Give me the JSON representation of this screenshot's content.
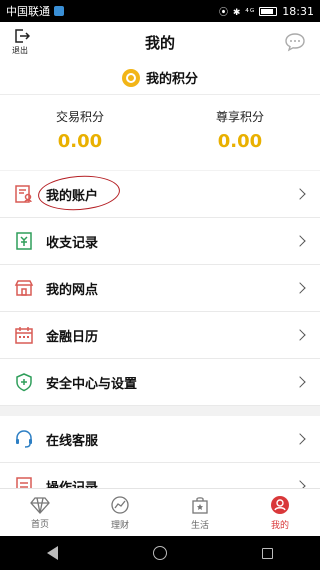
{
  "status_bar": {
    "carrier": "中国联通",
    "icons_text": "⦿ ✱ ⁴ᴳ",
    "time": "18:31"
  },
  "header": {
    "logout_label": "退出",
    "title": "我的",
    "points_title": "我的积分",
    "trade_points_label": "交易积分",
    "trade_points_value": "0.00",
    "premium_points_label": "尊享积分",
    "premium_points_value": "0.00"
  },
  "menu": {
    "group1": [
      {
        "label": "我的账户",
        "icon": "account-card-icon"
      },
      {
        "label": "收支记录",
        "icon": "ledger-icon"
      },
      {
        "label": "我的网点",
        "icon": "store-icon"
      },
      {
        "label": "金融日历",
        "icon": "calendar-icon"
      },
      {
        "label": "安全中心与设置",
        "icon": "shield-icon"
      }
    ],
    "group2": [
      {
        "label": "在线客服",
        "icon": "headset-icon"
      },
      {
        "label": "操作记录",
        "icon": "record-icon"
      }
    ]
  },
  "tabs": [
    {
      "label": "首页",
      "icon": "diamond-icon",
      "active": false
    },
    {
      "label": "理财",
      "icon": "chart-icon",
      "active": false
    },
    {
      "label": "生活",
      "icon": "shopping-bag-icon",
      "active": false
    },
    {
      "label": "我的",
      "icon": "profile-icon",
      "active": true
    }
  ],
  "colors": {
    "accent_red": "#d9383a",
    "gold": "#e9b000",
    "icon_red": "#d95b55",
    "icon_green": "#2e9e5a",
    "icon_blue": "#2d7fc4"
  }
}
